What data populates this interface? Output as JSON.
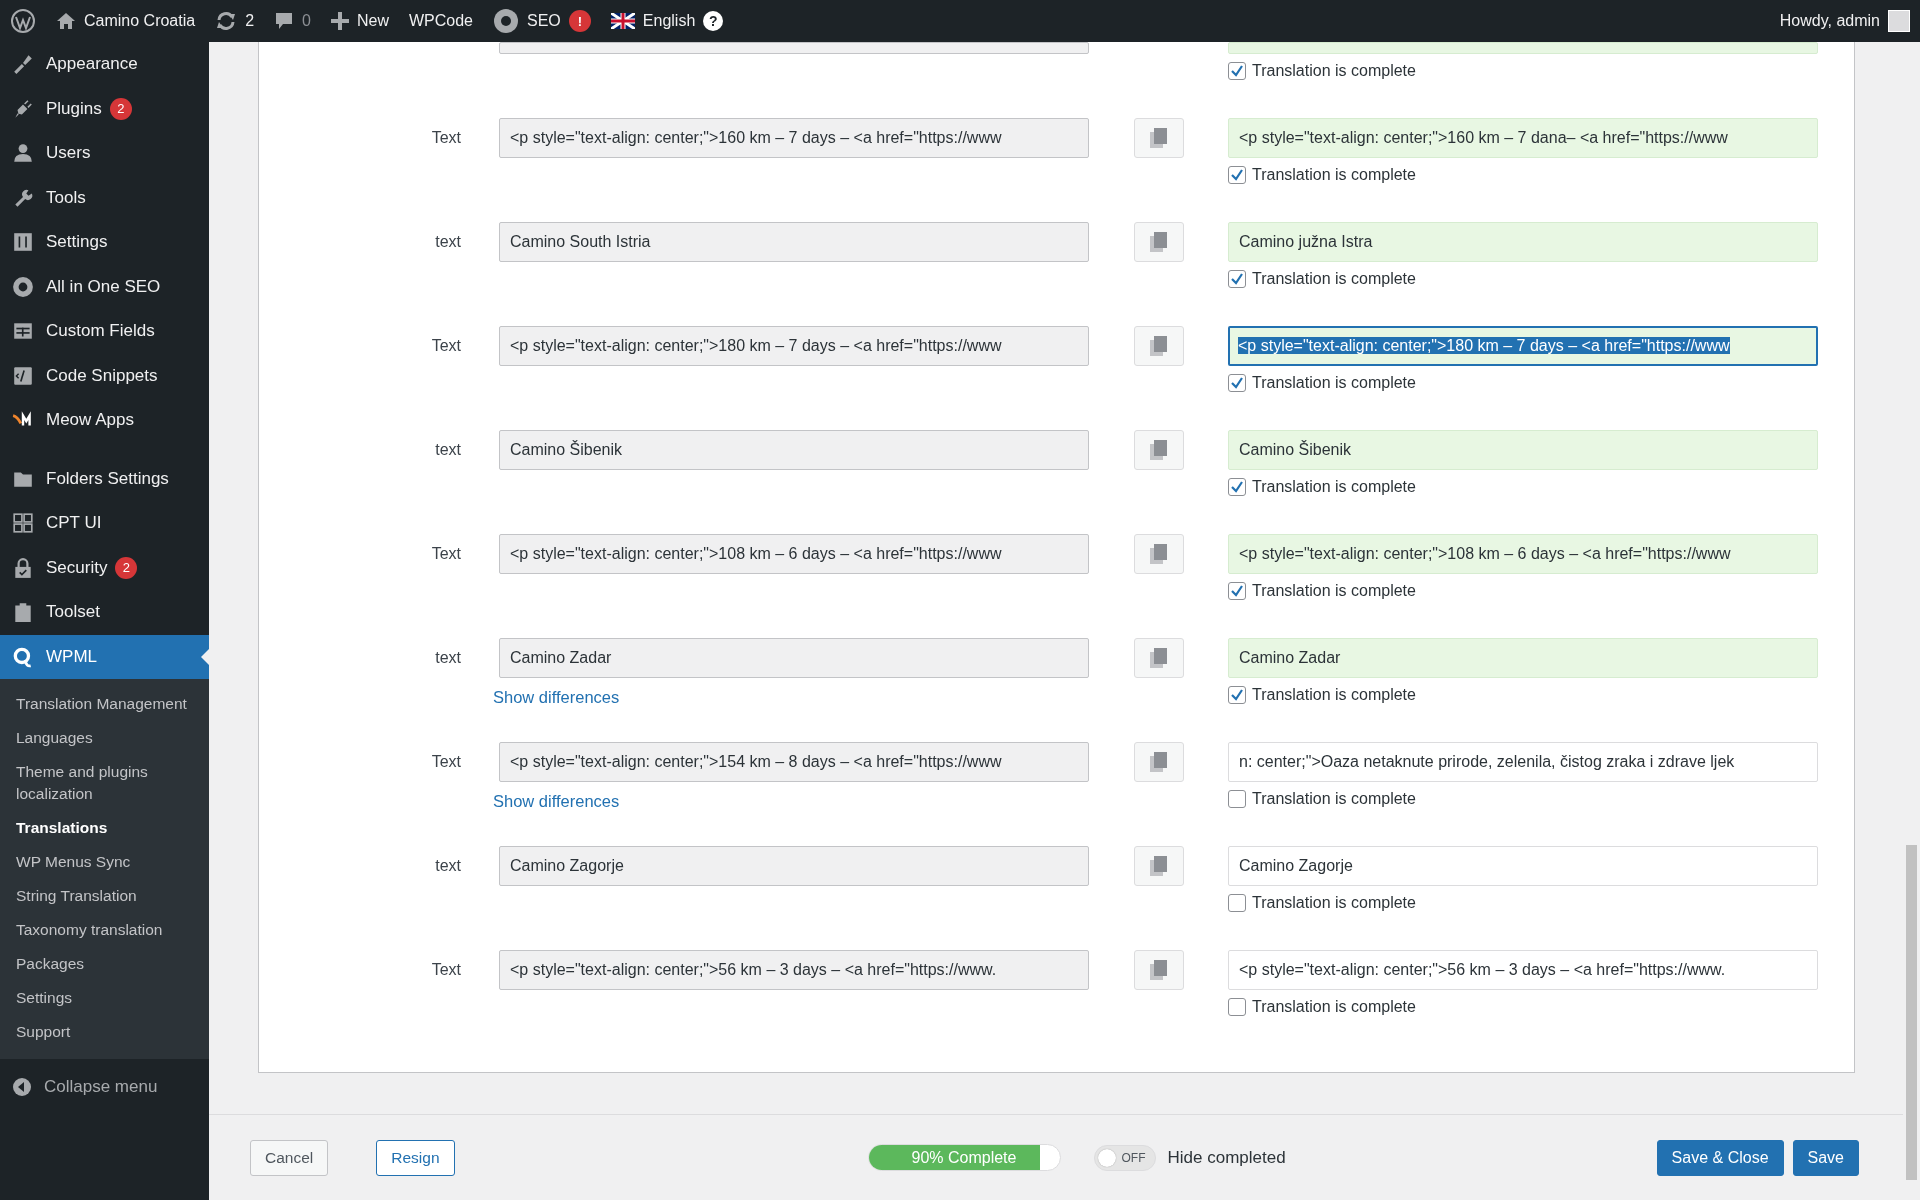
{
  "admin_bar": {
    "site": "Camino Croatia",
    "updates": "2",
    "comments": "0",
    "new": "New",
    "wpcode": "WPCode",
    "seo": "SEO",
    "seo_badge": "!",
    "language": "English",
    "language_help": "?",
    "greeting": "Howdy, admin"
  },
  "sidebar": {
    "items": [
      {
        "label": "Appearance",
        "selected": false
      },
      {
        "label": "Plugins",
        "badge": "2",
        "selected": false
      },
      {
        "label": "Users",
        "selected": false
      },
      {
        "label": "Tools",
        "selected": false
      },
      {
        "label": "Settings",
        "selected": false
      },
      {
        "label": "All in One SEO",
        "selected": false
      },
      {
        "label": "Custom Fields",
        "selected": false
      },
      {
        "label": "Code Snippets",
        "selected": false
      },
      {
        "label": "Meow Apps",
        "selected": false
      },
      {
        "label": "Folders Settings",
        "selected": false
      },
      {
        "label": "CPT UI",
        "selected": false
      },
      {
        "label": "Security",
        "badge": "2",
        "selected": false
      },
      {
        "label": "Toolset",
        "selected": false
      },
      {
        "label": "WPML",
        "selected": true
      }
    ],
    "submenu": [
      {
        "label": "Translation Management",
        "selected": false
      },
      {
        "label": "Languages",
        "selected": false
      },
      {
        "label": "Theme and plugins localization",
        "selected": false
      },
      {
        "label": "Translations",
        "selected": true
      },
      {
        "label": "WP Menus Sync",
        "selected": false
      },
      {
        "label": "String Translation",
        "selected": false
      },
      {
        "label": "Taxonomy translation",
        "selected": false
      },
      {
        "label": "Packages",
        "selected": false
      },
      {
        "label": "Settings",
        "selected": false
      },
      {
        "label": "Support",
        "selected": false
      }
    ],
    "collapse": "Collapse menu"
  },
  "partial_row": {
    "checkbox_label": "Translation is complete",
    "complete": true
  },
  "rows": [
    {
      "label": "Text",
      "source": "<p style=\"text-align: center;\">160 km – 7 days – <a href=\"https://www",
      "translation": "<p style=\"text-align: center;\">160 km – 7 dana– <a href=\"https://www",
      "checkbox_label": "Translation is complete",
      "complete": true,
      "focused": false
    },
    {
      "label": "text",
      "source": "Camino South Istria",
      "translation": "Camino južna Istra",
      "checkbox_label": "Translation is complete",
      "complete": true,
      "focused": false
    },
    {
      "label": "Text",
      "source": "<p style=\"text-align: center;\">180 km – 7 days – <a href=\"https://www",
      "translation": "<p style=\"text-align: center;\">180 km – 7 days – <a href=\"https://www",
      "checkbox_label": "Translation is complete",
      "complete": true,
      "focused": true
    },
    {
      "label": "text",
      "source": "Camino Šibenik",
      "translation": "Camino Šibenik",
      "checkbox_label": "Translation is complete",
      "complete": true,
      "focused": false
    },
    {
      "label": "Text",
      "source": "<p style=\"text-align: center;\">108 km – 6 days – <a href=\"https://www",
      "translation": "<p style=\"text-align: center;\">108 km – 6 days – <a href=\"https://www",
      "checkbox_label": "Translation is complete",
      "complete": true,
      "focused": false
    },
    {
      "label": "text",
      "source": "Camino Zadar",
      "translation": "Camino Zadar",
      "diff_link": "Show differences",
      "checkbox_label": "Translation is complete",
      "complete": true,
      "focused": false
    },
    {
      "label": "Text",
      "source": "<p style=\"text-align: center;\">154 km – 8 days – <a href=\"https://www",
      "translation": "n: center;\">Oaza netaknute prirode, zelenila, čistog zraka i zdrave ljek",
      "diff_link": "Show differences",
      "checkbox_label": "Translation is complete",
      "complete": false,
      "focused": false
    },
    {
      "label": "text",
      "source": "Camino Zagorje",
      "translation": "Camino Zagorje",
      "checkbox_label": "Translation is complete",
      "complete": false,
      "focused": false
    },
    {
      "label": "Text",
      "source": "<p style=\"text-align: center;\">56 km – 3 days – <a href=\"https://www.",
      "translation": "<p style=\"text-align: center;\">56 km – 3 days – <a href=\"https://www.",
      "checkbox_label": "Translation is complete",
      "complete": false,
      "focused": false
    }
  ],
  "footer": {
    "cancel": "Cancel",
    "resign": "Resign",
    "progress": {
      "text": "90% Complete",
      "level": 0.9
    },
    "toggle": {
      "state_label": "OFF",
      "on": false,
      "caption": "Hide completed"
    },
    "save_close": "Save & Close",
    "save": "Save"
  }
}
